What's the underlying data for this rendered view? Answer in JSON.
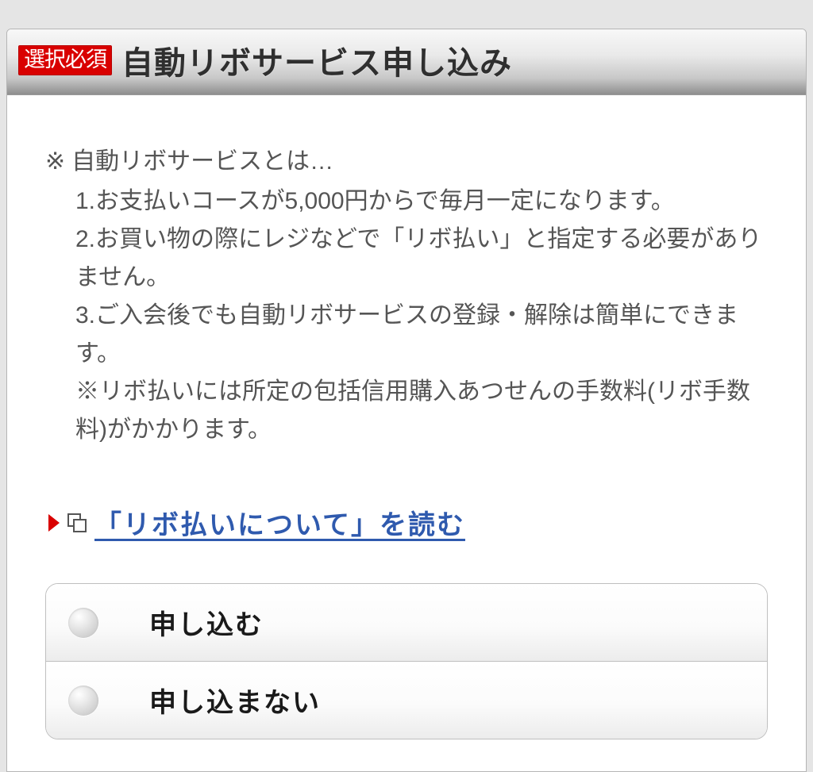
{
  "header": {
    "required_badge": "選択必須",
    "title": "自動リボサービス申し込み"
  },
  "notes": {
    "mark": "※",
    "lead": "自動リボサービスとは…",
    "items": [
      "1.お支払いコースが5,000円からで毎月一定になります。",
      "2.お買い物の際にレジなどで「リボ払い」と指定する必要がありません。",
      "3.ご入会後でも自動リボサービスの登録・解除は簡単にできます。",
      "※リボ払いには所定の包括信用購入あつせんの手数料(リボ手数料)がかかります。"
    ]
  },
  "link": {
    "text": "「リボ払いについて」を読む"
  },
  "options": {
    "apply": "申し込む",
    "decline": "申し込まない"
  }
}
